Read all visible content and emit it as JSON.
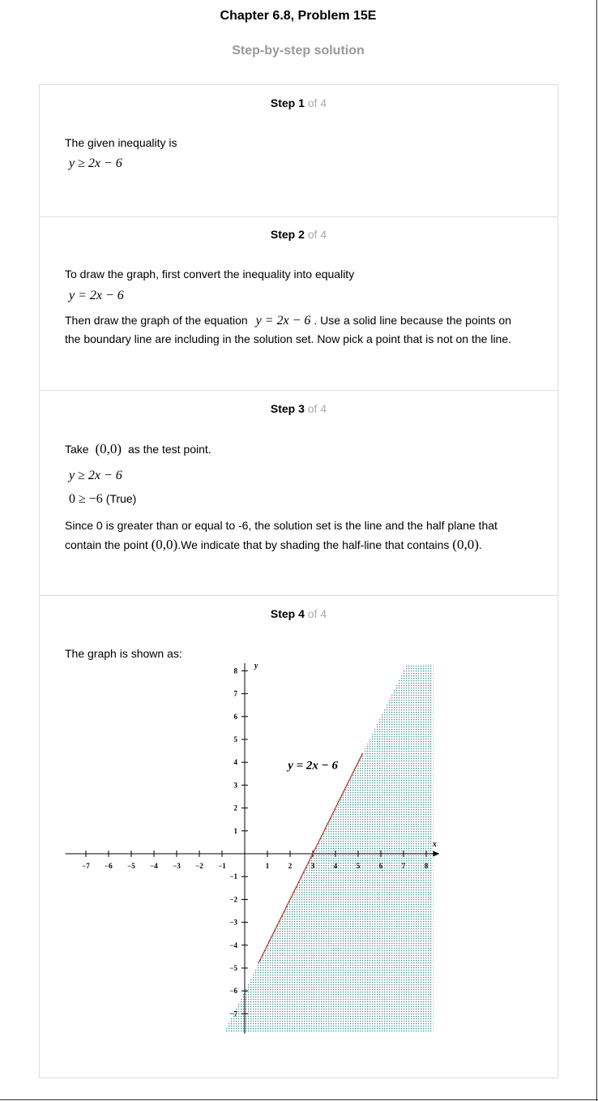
{
  "header": {
    "title": "Chapter 6.8, Problem 15E",
    "subtitle": "Step-by-step solution"
  },
  "steps": [
    {
      "label": "Step 1",
      "of": " of 4",
      "text1": "The given inequality is",
      "eq1": "y ≥ 2x − 6"
    },
    {
      "label": "Step 2",
      "of": " of 4",
      "text1": "To draw the graph, first convert the inequality into equality",
      "eq1": "y = 2x − 6",
      "text2a": "Then draw the graph of the equation",
      "eq2": "y = 2x − 6",
      "text2b": ". Use a solid line because the points on",
      "text3": "the boundary line are including in the solution set. Now pick a point that is not on the line."
    },
    {
      "label": "Step 3",
      "of": " of 4",
      "text1a": "Take",
      "pt": "(0,0)",
      "text1b": "as the test point.",
      "eq1": "y ≥ 2x − 6",
      "eq2": "0 ≥ −6",
      "eq2_note": "(True)",
      "text2": "Since 0 is greater than or equal to -6, the solution set is the line and the half plane that",
      "text3a": "contain the point",
      "text3b": ".We indicate that by shading the half-line that contains",
      "text3c": "."
    },
    {
      "label": "Step 4",
      "of": " of 4",
      "text1": "The graph is shown as:"
    }
  ],
  "chart_data": {
    "type": "line",
    "equation_label": "y = 2x − 6",
    "line": {
      "slope": 2,
      "intercept": -6,
      "x_start": 0.6,
      "x_end": 5.2
    },
    "shaded_region": "y ≥ 2x − 6 (right of line)",
    "xlim": [
      -7.8,
      8.3
    ],
    "ylim": [
      -7.8,
      8.3
    ],
    "x_ticks": [
      -7,
      -6,
      -5,
      -4,
      -3,
      -2,
      -1,
      1,
      2,
      3,
      4,
      5,
      6,
      7,
      8
    ],
    "y_ticks": [
      -7,
      -6,
      -5,
      -4,
      -3,
      -2,
      -1,
      1,
      2,
      3,
      4,
      5,
      6,
      7,
      8
    ],
    "xlabel": "x",
    "ylabel": "y",
    "colors": {
      "line": "#b53a2a",
      "shade": "#3f8f8f"
    }
  }
}
